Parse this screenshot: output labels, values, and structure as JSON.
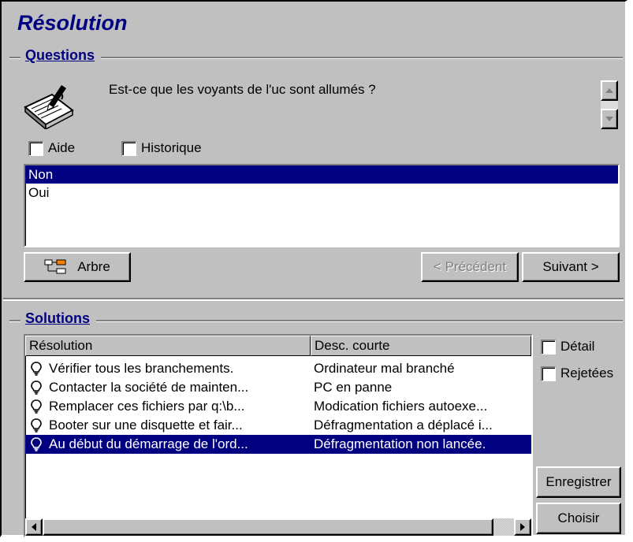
{
  "window": {
    "title": "Résolution"
  },
  "questions": {
    "legend": "Questions",
    "question_text": "Est-ce que les voyants de l'uc sont allumés ?",
    "aide_label": "Aide",
    "historique_label": "Historique",
    "answers": [
      "Non",
      "Oui"
    ],
    "selected_answer": "Non",
    "arbre_label": "Arbre",
    "precedent_label": "< Précédent",
    "suivant_label": "Suivant >"
  },
  "solutions": {
    "legend": "Solutions",
    "columns": [
      "Résolution",
      "Desc. courte"
    ],
    "rows": [
      {
        "resolution": "Vérifier tous les branchements.",
        "desc": "Ordinateur mal branché",
        "selected": false
      },
      {
        "resolution": "Contacter la société de mainten...",
        "desc": "PC en panne",
        "selected": false
      },
      {
        "resolution": "Remplacer ces fichiers par q:\\b...",
        "desc": "Modication fichiers autoexe...",
        "selected": false
      },
      {
        "resolution": "Booter sur une disquette et fair...",
        "desc": "Défragmentation a déplacé i...",
        "selected": false
      },
      {
        "resolution": "Au début du démarrage de l'ord...",
        "desc": "Défragmentation non lancée.",
        "selected": true
      }
    ],
    "detail_label": "Détail",
    "rejetees_label": "Rejetées",
    "enregistrer_label": "Enregistrer",
    "choisir_label": "Choisir"
  },
  "colors": {
    "face": "#c0c0c0",
    "selection": "#000080",
    "title": "#000080"
  },
  "icons": [
    "notepad-pen-icon",
    "tree-icon",
    "lightbulb-icon",
    "scroll-up-icon",
    "scroll-down-icon",
    "scroll-left-icon",
    "scroll-right-icon"
  ]
}
